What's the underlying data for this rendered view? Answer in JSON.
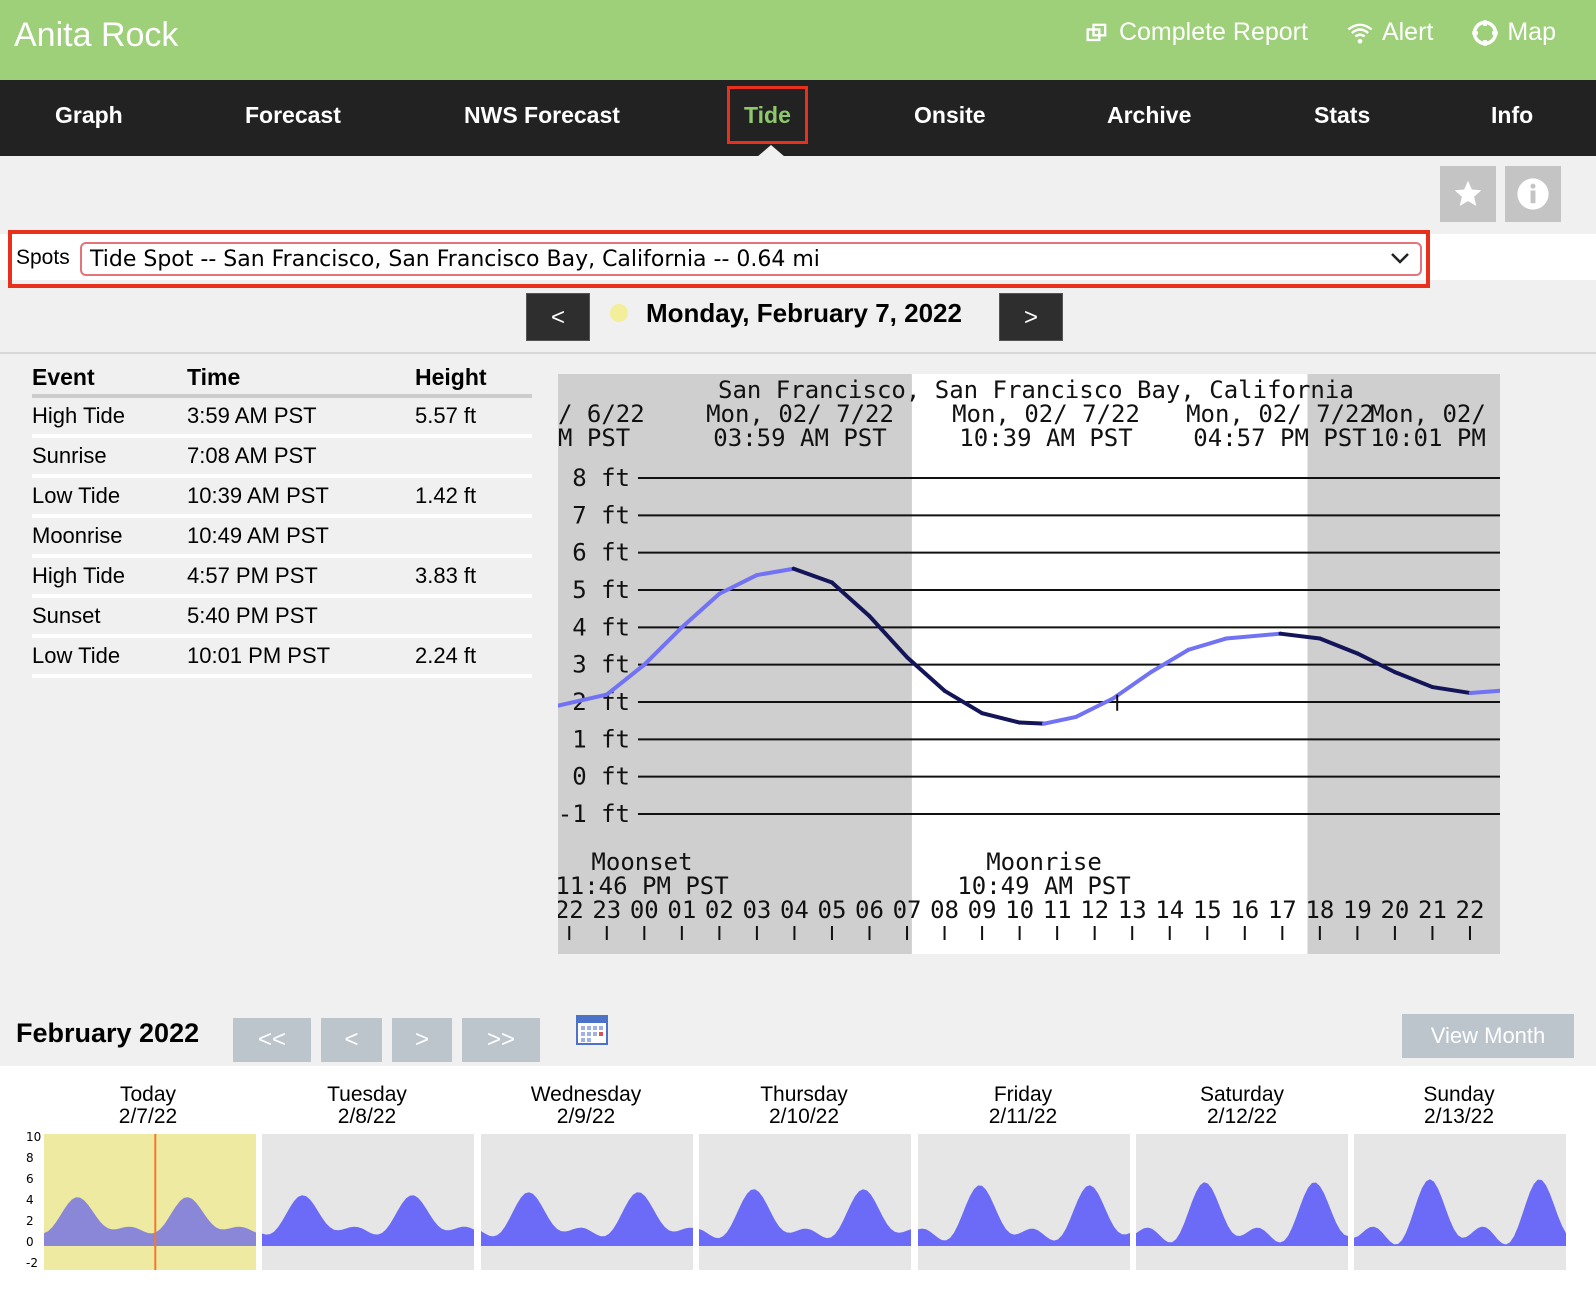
{
  "header": {
    "site_title": "Anita Rock",
    "links": [
      {
        "label": "Complete Report",
        "icon": "external-link-icon"
      },
      {
        "label": "Alert",
        "icon": "wifi-alert-icon"
      },
      {
        "label": "Map",
        "icon": "map-target-icon"
      }
    ]
  },
  "nav": {
    "tabs": [
      {
        "label": "Graph"
      },
      {
        "label": "Forecast"
      },
      {
        "label": "NWS Forecast"
      },
      {
        "label": "Tide",
        "active": true
      },
      {
        "label": "Onsite"
      },
      {
        "label": "Archive"
      },
      {
        "label": "Stats"
      },
      {
        "label": "Info"
      }
    ]
  },
  "toolbar": {
    "favorite_icon": "star-icon",
    "info_icon": "info-icon"
  },
  "spots": {
    "label": "Spots",
    "selected": "Tide Spot -- San Francisco, San Francisco Bay, California -- 0.64 mi"
  },
  "date_nav": {
    "prev": "<",
    "next": ">",
    "date": "Monday, February 7, 2022",
    "moon_color": "#f2ee9a"
  },
  "tide_table": {
    "headers": [
      "Event",
      "Time",
      "Height"
    ],
    "rows": [
      [
        "High Tide",
        "3:59 AM PST",
        "5.57 ft"
      ],
      [
        "Sunrise",
        "7:08 AM PST",
        ""
      ],
      [
        "Low Tide",
        "10:39 AM PST",
        "1.42 ft"
      ],
      [
        "Moonrise",
        "10:49 AM PST",
        ""
      ],
      [
        "High Tide",
        "4:57 PM PST",
        "3.83 ft"
      ],
      [
        "Sunset",
        "5:40 PM PST",
        ""
      ],
      [
        "Low Tide",
        "10:01 PM PST",
        "2.24 ft"
      ]
    ]
  },
  "chart_data": {
    "type": "line",
    "title": "San Francisco, San Francisco Bay, California",
    "event_labels": [
      {
        "text1": "/ 6/22",
        "text2": "M PST"
      },
      {
        "text1": "Mon, 02/ 7/22",
        "text2": "03:59 AM PST"
      },
      {
        "text1": "Mon, 02/ 7/22",
        "text2": "10:39 AM PST"
      },
      {
        "text1": "Mon, 02/ 7/22",
        "text2": "04:57 PM PST"
      },
      {
        "text1": "Mon, 02/",
        "text2": "10:01 PM"
      }
    ],
    "y_ticks": [
      "8 ft",
      "7 ft",
      "6 ft",
      "5 ft",
      "4 ft",
      "3 ft",
      "2 ft",
      "1 ft",
      "0 ft",
      "-1 ft"
    ],
    "ylim": [
      -1,
      8
    ],
    "x_ticks": [
      "22",
      "23",
      "00",
      "01",
      "02",
      "03",
      "04",
      "05",
      "06",
      "07",
      "08",
      "09",
      "10",
      "11",
      "12",
      "13",
      "14",
      "15",
      "16",
      "17",
      "18",
      "19",
      "20",
      "21",
      "22"
    ],
    "x_range_hours": [
      -2.3,
      22.8
    ],
    "daylight_hours": [
      7.13,
      17.67
    ],
    "moon_events": [
      {
        "text1": "Moonset",
        "text2": "11:46 PM PST"
      },
      {
        "text1": "Moonrise",
        "text2": "10:49 AM PST"
      }
    ],
    "series": [
      {
        "x": [
          -2.3,
          -1,
          0,
          1,
          2,
          3,
          3.98,
          5,
          6,
          7,
          8,
          9,
          10,
          10.65,
          11.5,
          12.5,
          13.5,
          14.5,
          15.5,
          16.95,
          18,
          19,
          20,
          21,
          22.02,
          22.8
        ],
        "y": [
          1.9,
          2.2,
          3.0,
          4.0,
          4.9,
          5.4,
          5.57,
          5.2,
          4.3,
          3.2,
          2.3,
          1.7,
          1.45,
          1.42,
          1.6,
          2.1,
          2.8,
          3.4,
          3.7,
          3.83,
          3.7,
          3.3,
          2.8,
          2.4,
          2.24,
          2.3
        ]
      }
    ]
  },
  "week": {
    "title": "February 2022",
    "buttons": [
      "<<",
      "<",
      ">",
      ">>"
    ],
    "calendar_icon": "calendar-icon",
    "view_month": "View Month",
    "y_ticks": [
      "10",
      "8",
      "6",
      "4",
      "2",
      "0",
      "-2"
    ],
    "days": [
      {
        "name": "Today",
        "date": "2/7/22",
        "today": true
      },
      {
        "name": "Tuesday",
        "date": "2/8/22"
      },
      {
        "name": "Wednesday",
        "date": "2/9/22"
      },
      {
        "name": "Thursday",
        "date": "2/10/22"
      },
      {
        "name": "Friday",
        "date": "2/11/22"
      },
      {
        "name": "Saturday",
        "date": "2/12/22"
      },
      {
        "name": "Sunday",
        "date": "2/13/22"
      }
    ],
    "colors": {
      "fill": "#6b6bf7",
      "today_bg": "#eeeaa2",
      "now_line": "#f07a2a"
    }
  }
}
